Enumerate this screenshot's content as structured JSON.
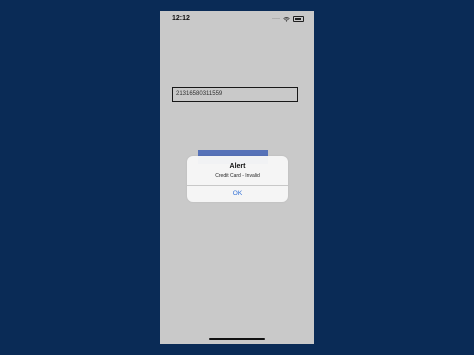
{
  "status_bar": {
    "time": "12:12",
    "icons": [
      "cellular-dots-icon",
      "wifi-icon",
      "battery-icon"
    ]
  },
  "form": {
    "card_number_value": "21316580311559",
    "submit_button_color": "#5b79c2"
  },
  "alert": {
    "title": "Alert",
    "message": "Credit Card - Invalid",
    "ok_label": "OK",
    "ok_color": "#2f6fd6"
  },
  "colors": {
    "page_background": "#0a2b56",
    "screen_background": "#d4d4d4"
  }
}
